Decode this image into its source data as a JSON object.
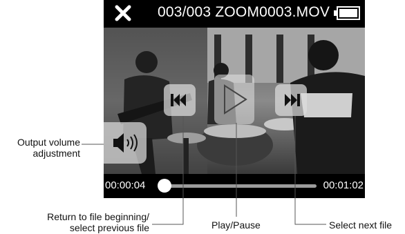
{
  "player": {
    "file_title": "003/003 ZOOM0003.MOV",
    "elapsed_time": "00:00:04",
    "total_time": "00:01:02",
    "playback_progress_fraction": 0.065
  },
  "annotations": {
    "volume_line1": "Output volume",
    "volume_line2": "adjustment",
    "prev_line1": "Return to file beginning/",
    "prev_line2": "select previous file",
    "play_pause": "Play/Pause",
    "next_file": "Select next file"
  },
  "icons": [
    "close-icon",
    "battery-icon",
    "previous-track-icon",
    "play-icon",
    "next-track-icon",
    "speaker-icon"
  ],
  "colors": {
    "screen_background": "#000000",
    "control_overlay": "#dcdcdc",
    "seek_track": "#9c9c9c"
  }
}
